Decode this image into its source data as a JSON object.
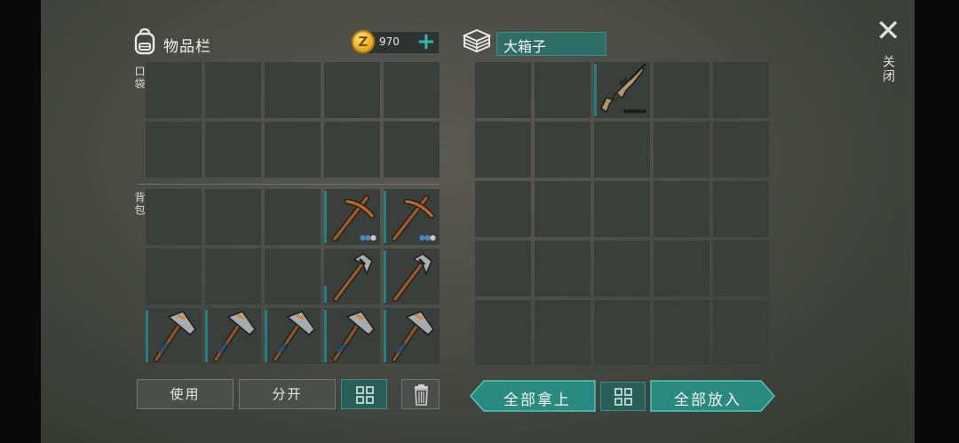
{
  "inventory": {
    "title": "物品栏",
    "money": "970",
    "coin_glyph": "Z",
    "add_glyph": "+",
    "section_pocket": "口袋",
    "section_backpack": "背包",
    "backpack_items": [
      {
        "icon": "pickaxe-icon",
        "durability": "●●●",
        "dots_on": 2
      },
      {
        "icon": "pickaxe-icon",
        "durability": "●●●",
        "dots_on": 2
      },
      {
        "icon": "stone-pickaxe-icon"
      },
      {
        "icon": "stone-pickaxe-icon"
      },
      {
        "icon": "stone-axe-icon"
      },
      {
        "icon": "stone-axe-icon"
      },
      {
        "icon": "stone-axe-icon"
      },
      {
        "icon": "stone-axe-icon"
      },
      {
        "icon": "stone-axe-icon"
      }
    ]
  },
  "chest": {
    "name": "大箱子",
    "items": [
      {
        "icon": "assault-rifle-icon",
        "durability": "●●●●●●"
      }
    ]
  },
  "buttons": {
    "use": "使用",
    "split": "分开",
    "take_all": "全部拿上",
    "put_all": "全部放入"
  },
  "close": {
    "glyph": "✕",
    "label": "关闭"
  },
  "colors": {
    "accent_teal": "#227f86",
    "button_teal": "#2b8a7f",
    "slot_bg": "#3b3f3c"
  }
}
